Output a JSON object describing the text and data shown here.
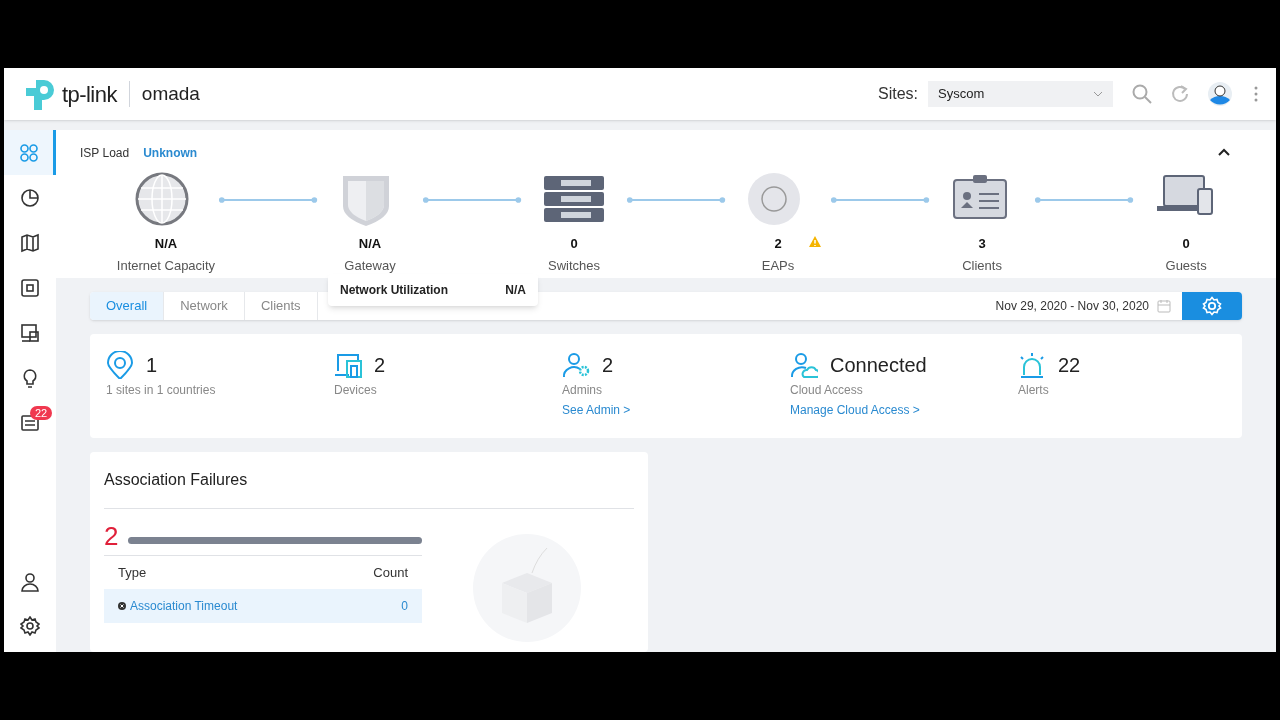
{
  "header": {
    "brand": "tp-link",
    "product": "omada",
    "sites_label": "Sites:",
    "site": "Syscom"
  },
  "sidebar": {
    "items": [
      {
        "kind": "dashboard",
        "selected": true
      },
      {
        "kind": "statistics",
        "selected": false
      },
      {
        "kind": "map",
        "selected": false
      },
      {
        "kind": "devices",
        "selected": false
      },
      {
        "kind": "clients",
        "selected": false
      },
      {
        "kind": "insight",
        "selected": false
      },
      {
        "kind": "logs",
        "selected": false,
        "badge": "22"
      }
    ],
    "bottom": [
      {
        "kind": "account"
      },
      {
        "kind": "settings"
      }
    ]
  },
  "topology": {
    "isp_label": "ISP Load",
    "isp_value": "Unknown",
    "nodes": [
      {
        "kind": "globe",
        "value": "N/A",
        "label": "Internet Capacity",
        "warning": false
      },
      {
        "kind": "gateway",
        "value": "N/A",
        "label": "Gateway",
        "warning": false
      },
      {
        "kind": "switch",
        "value": "0",
        "label": "Switches",
        "warning": false
      },
      {
        "kind": "ap",
        "value": "2",
        "label": "EAPs",
        "warning": true
      },
      {
        "kind": "clients",
        "value": "3",
        "label": "Clients",
        "warning": false
      },
      {
        "kind": "guests",
        "value": "0",
        "label": "Guests",
        "warning": false
      }
    ],
    "tooltip": {
      "label": "Network Utilization",
      "value": "N/A"
    }
  },
  "tabs": [
    {
      "label": "Overall",
      "selected": true
    },
    {
      "label": "Network",
      "selected": false
    },
    {
      "label": "Clients",
      "selected": false
    }
  ],
  "date_range": "Nov 29, 2020 - Nov 30, 2020",
  "stats": [
    {
      "kind": "site",
      "value": "1",
      "label": "1 sites in 1 countries"
    },
    {
      "kind": "devices",
      "value": "2",
      "label": "Devices"
    },
    {
      "kind": "admins",
      "value": "2",
      "label": "Admins",
      "link": "See Admin >"
    },
    {
      "kind": "cloud",
      "value": "Connected",
      "label": "Cloud Access",
      "link": "Manage Cloud Access >"
    },
    {
      "kind": "alerts",
      "value": "22",
      "label": "Alerts"
    }
  ],
  "association_failures": {
    "title": "Association Failures",
    "total": "2",
    "level": 1,
    "columns": [
      "Type",
      "Count"
    ],
    "rows": [
      {
        "type": "Association Timeout",
        "count": "0"
      }
    ]
  }
}
